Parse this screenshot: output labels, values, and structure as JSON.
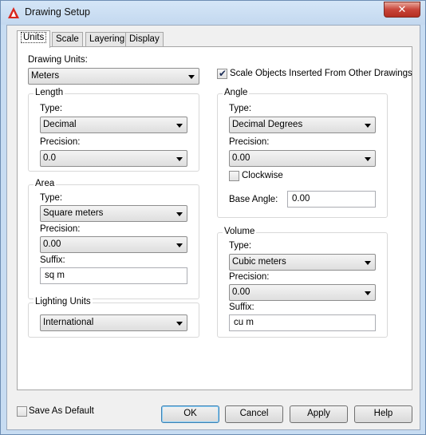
{
  "window": {
    "title": "Drawing Setup",
    "close_label": "✕"
  },
  "tabs": [
    {
      "label": "Units",
      "active": true
    },
    {
      "label": "Scale",
      "active": false
    },
    {
      "label": "Layering",
      "active": false
    },
    {
      "label": "Display",
      "active": false
    }
  ],
  "units": {
    "drawing_units_label": "Drawing Units:",
    "drawing_units_value": "Meters",
    "scale_objects_label": "Scale Objects Inserted From Other Drawings",
    "scale_objects_checked": true,
    "length": {
      "legend": "Length",
      "type_label": "Type:",
      "type_value": "Decimal",
      "precision_label": "Precision:",
      "precision_value": "0.0"
    },
    "area": {
      "legend": "Area",
      "type_label": "Type:",
      "type_value": "Square meters",
      "precision_label": "Precision:",
      "precision_value": "0.00",
      "suffix_label": "Suffix:",
      "suffix_value": "sq m"
    },
    "lighting": {
      "legend": "Lighting Units",
      "value": "International"
    },
    "angle": {
      "legend": "Angle",
      "type_label": "Type:",
      "type_value": "Decimal Degrees",
      "precision_label": "Precision:",
      "precision_value": "0.00",
      "clockwise_label": "Clockwise",
      "clockwise_checked": false,
      "base_angle_label": "Base Angle:",
      "base_angle_value": "0.00"
    },
    "volume": {
      "legend": "Volume",
      "type_label": "Type:",
      "type_value": "Cubic meters",
      "precision_label": "Precision:",
      "precision_value": "0.00",
      "suffix_label": "Suffix:",
      "suffix_value": "cu m"
    }
  },
  "footer": {
    "save_default_label": "Save As Default",
    "save_default_checked": false,
    "ok_label": "OK",
    "cancel_label": "Cancel",
    "apply_label": "Apply",
    "help_label": "Help"
  },
  "colors": {
    "accent": "#3c7fb1",
    "close": "#c8453a",
    "frame": "#c7dcf2"
  },
  "icons": {
    "app": "autocad-a-icon",
    "dropdown": "chevron-down-icon",
    "check": "checkmark-icon"
  }
}
